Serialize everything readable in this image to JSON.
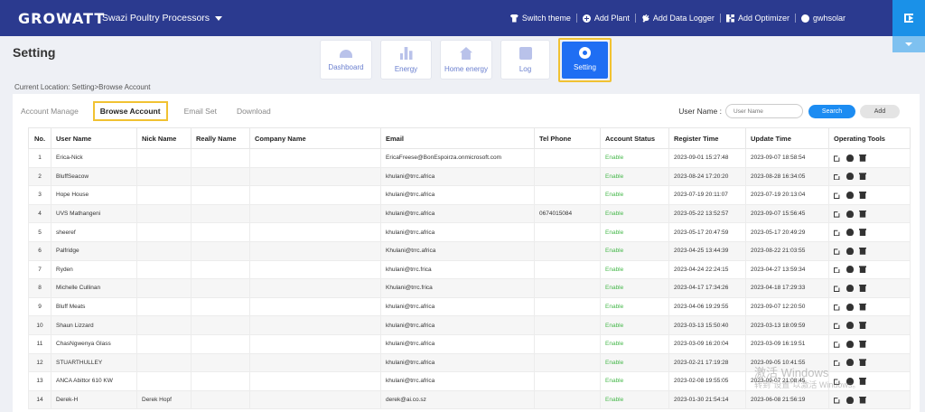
{
  "header": {
    "logo": "GROWATT",
    "plant": "Swazi Poultry Processors",
    "actions": [
      {
        "label": "Switch theme",
        "icon": "shirt-icon"
      },
      {
        "label": "Add Plant",
        "icon": "plus-circle-icon"
      },
      {
        "label": "Add Data Logger",
        "icon": "plug-icon"
      },
      {
        "label": "Add Optimizer",
        "icon": "grid-icon"
      },
      {
        "label": "gwhsolar",
        "icon": "user-icon"
      }
    ]
  },
  "page": {
    "title": "Setting",
    "breadcrumb": "Current Location: Setting>Browse Account"
  },
  "modules": [
    {
      "label": "Dashboard",
      "icon": "gauge-icon"
    },
    {
      "label": "Energy",
      "icon": "bar-chart-icon"
    },
    {
      "label": "Home energy",
      "icon": "home-icon"
    },
    {
      "label": "Log",
      "icon": "log-icon"
    },
    {
      "label": "Setting",
      "icon": "gear-icon",
      "active": true
    }
  ],
  "tabs": [
    "Account Manage",
    "Browse Account",
    "Email Set",
    "Download"
  ],
  "search": {
    "label": "User Name :",
    "placeholder": "User Name",
    "search_btn": "Search",
    "add_btn": "Add"
  },
  "table": {
    "headers": [
      "No.",
      "User Name",
      "Nick Name",
      "Really Name",
      "Company Name",
      "Email",
      "Tel Phone",
      "Account Status",
      "Register Time",
      "Update Time",
      "Operating Tools"
    ],
    "rows": [
      [
        "1",
        "Erica-Nick",
        "",
        "",
        "",
        "EricaFreese@BonEspoirza.onmicrosoft.com",
        "",
        "Enable",
        "2023-09-01 15:27:48",
        "2023-09-07 18:58:54"
      ],
      [
        "2",
        "BluffSeacow",
        "",
        "",
        "",
        "khulani@trrc.africa",
        "",
        "Enable",
        "2023-08-24 17:20:20",
        "2023-08-28 16:34:05"
      ],
      [
        "3",
        "Hope House",
        "",
        "",
        "",
        "khulani@trrc.africa",
        "",
        "Enable",
        "2023-07-19 20:11:07",
        "2023-07-19 20:13:04"
      ],
      [
        "4",
        "UVS Mathangeni",
        "",
        "",
        "",
        "khulani@trrc.africa",
        "0674015084",
        "Enable",
        "2023-05-22 13:52:57",
        "2023-09-07 15:56:45"
      ],
      [
        "5",
        "sheeref",
        "",
        "",
        "",
        "khulani@trrc.africa",
        "",
        "Enable",
        "2023-05-17 20:47:59",
        "2023-05-17 20:49:29"
      ],
      [
        "6",
        "Palfridge",
        "",
        "",
        "",
        "Khulani@trrc.africa",
        "",
        "Enable",
        "2023-04-25 13:44:39",
        "2023-08-22 21:03:55"
      ],
      [
        "7",
        "Ryden",
        "",
        "",
        "",
        "khulani@trrc.frica",
        "",
        "Enable",
        "2023-04-24 22:24:15",
        "2023-04-27 13:59:34"
      ],
      [
        "8",
        "Michelle Cullinan",
        "",
        "",
        "",
        "Khulani@trrc.frica",
        "",
        "Enable",
        "2023-04-17 17:34:26",
        "2023-04-18 17:29:33"
      ],
      [
        "9",
        "Bluff Meats",
        "",
        "",
        "",
        "khulani@trrc.africa",
        "",
        "Enable",
        "2023-04-06 19:29:55",
        "2023-09-07 12:20:50"
      ],
      [
        "10",
        "Shaun Lizzard",
        "",
        "",
        "",
        "khulani@trrc.africa",
        "",
        "Enable",
        "2023-03-13 15:50:40",
        "2023-03-13 18:09:59"
      ],
      [
        "11",
        "ChasNgwenya Glass",
        "",
        "",
        "",
        "khulani@trrc.africa",
        "",
        "Enable",
        "2023-03-09 16:20:04",
        "2023-03-09 16:19:51"
      ],
      [
        "12",
        "STUARTHULLEY",
        "",
        "",
        "",
        "khulani@trrc.africa",
        "",
        "Enable",
        "2023-02-21 17:19:28",
        "2023-09-05 10:41:55"
      ],
      [
        "13",
        "ANCA Abittor 610 KW",
        "",
        "",
        "",
        "khulani@trrc.africa",
        "",
        "Enable",
        "2023-02-08 19:55:05",
        "2023-09-07 21:08:45"
      ],
      [
        "14",
        "Derek-H",
        "Derek Hopf",
        "",
        "",
        "derek@ai.co.sz",
        "",
        "Enable",
        "2023-01-30 21:54:14",
        "2023-06-08 21:56:19"
      ]
    ]
  },
  "watermark": {
    "line1": "激活 Windows",
    "line2": "转到\"设置\"以激活 Windows。"
  },
  "colors": {
    "header_bg": "#2b3a8f",
    "accent": "#1f6ef3",
    "enable": "#45b84a",
    "highlight": "#f1c232"
  }
}
